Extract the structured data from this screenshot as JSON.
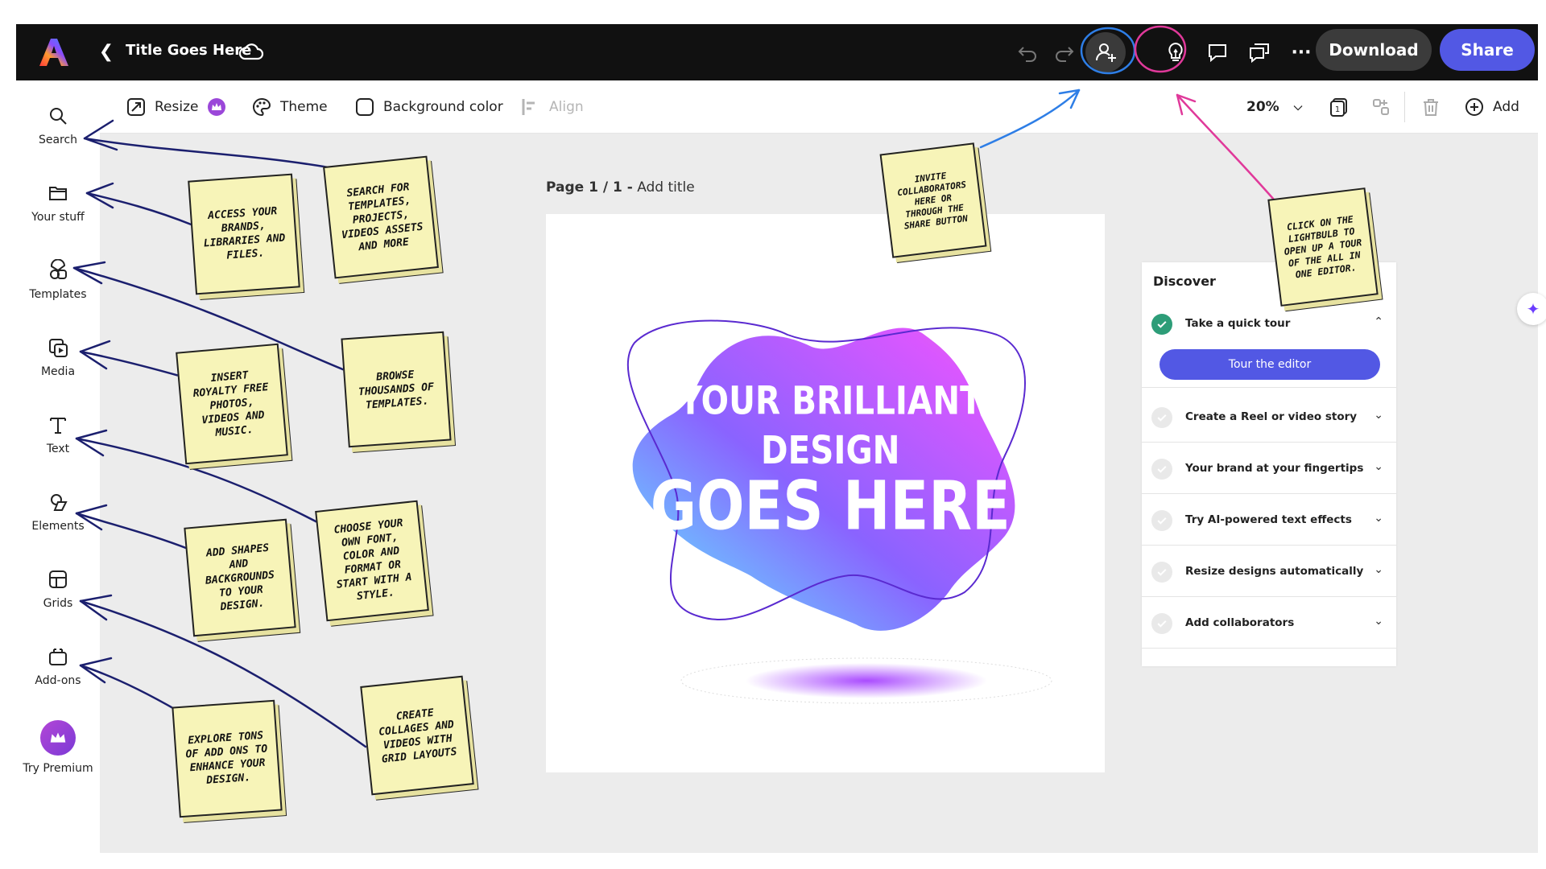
{
  "topbar": {
    "doc_title": "Title Goes Here",
    "download_label": "Download",
    "share_label": "Share"
  },
  "sidebar": {
    "items": [
      {
        "label": "Search",
        "icon": "search-icon"
      },
      {
        "label": "Your stuff",
        "icon": "folder-icon"
      },
      {
        "label": "Templates",
        "icon": "templates-icon"
      },
      {
        "label": "Media",
        "icon": "media-icon"
      },
      {
        "label": "Text",
        "icon": "text-icon"
      },
      {
        "label": "Elements",
        "icon": "elements-icon"
      },
      {
        "label": "Grids",
        "icon": "grid-icon"
      },
      {
        "label": "Add-ons",
        "icon": "addons-icon"
      }
    ],
    "premium_label": "Try Premium"
  },
  "toolbar": {
    "resize": "Resize",
    "theme": "Theme",
    "background": "Background color",
    "align": "Align",
    "zoom": "20%",
    "add": "Add"
  },
  "canvas": {
    "page_label": "Page 1 / 1 -",
    "add_title": "Add title",
    "design_line1": "YOUR BRILLIANT",
    "design_line2": "DESIGN",
    "design_line3": "GOES HERE"
  },
  "discover": {
    "title": "Discover",
    "tour_item": "Take a quick tour",
    "tour_button": "Tour the editor",
    "items": [
      "Create a Reel or video story",
      "Your brand at your fingertips",
      "Try AI-powered text effects",
      "Resize designs automatically",
      "Add collaborators"
    ]
  },
  "notes": {
    "search": "Search for templates, projects, videos assets and more",
    "your_stuff": "Access your brands, libraries and files.",
    "templates": "Browse thousands of templates.",
    "media": "Insert royalty free photos, videos and music.",
    "text": "Choose your own font, color and format or start with a style.",
    "elements": "Add shapes and backgrounds to your design.",
    "addons": "Explore tons of add ons to enhance your design.",
    "grids": "Create collages and videos with grid layouts",
    "invite": "Invite collaborators here or through the share button",
    "lightbulb": "Click on the lightbulb to open up a tour of the all in one editor."
  },
  "colors": {
    "topbar": "#111111",
    "accent": "#5258e4",
    "note": "#f7f4b8",
    "arrow_navy": "#1b1f6e",
    "arrow_blue": "#2e7ee6",
    "arrow_pink": "#e0399a"
  }
}
